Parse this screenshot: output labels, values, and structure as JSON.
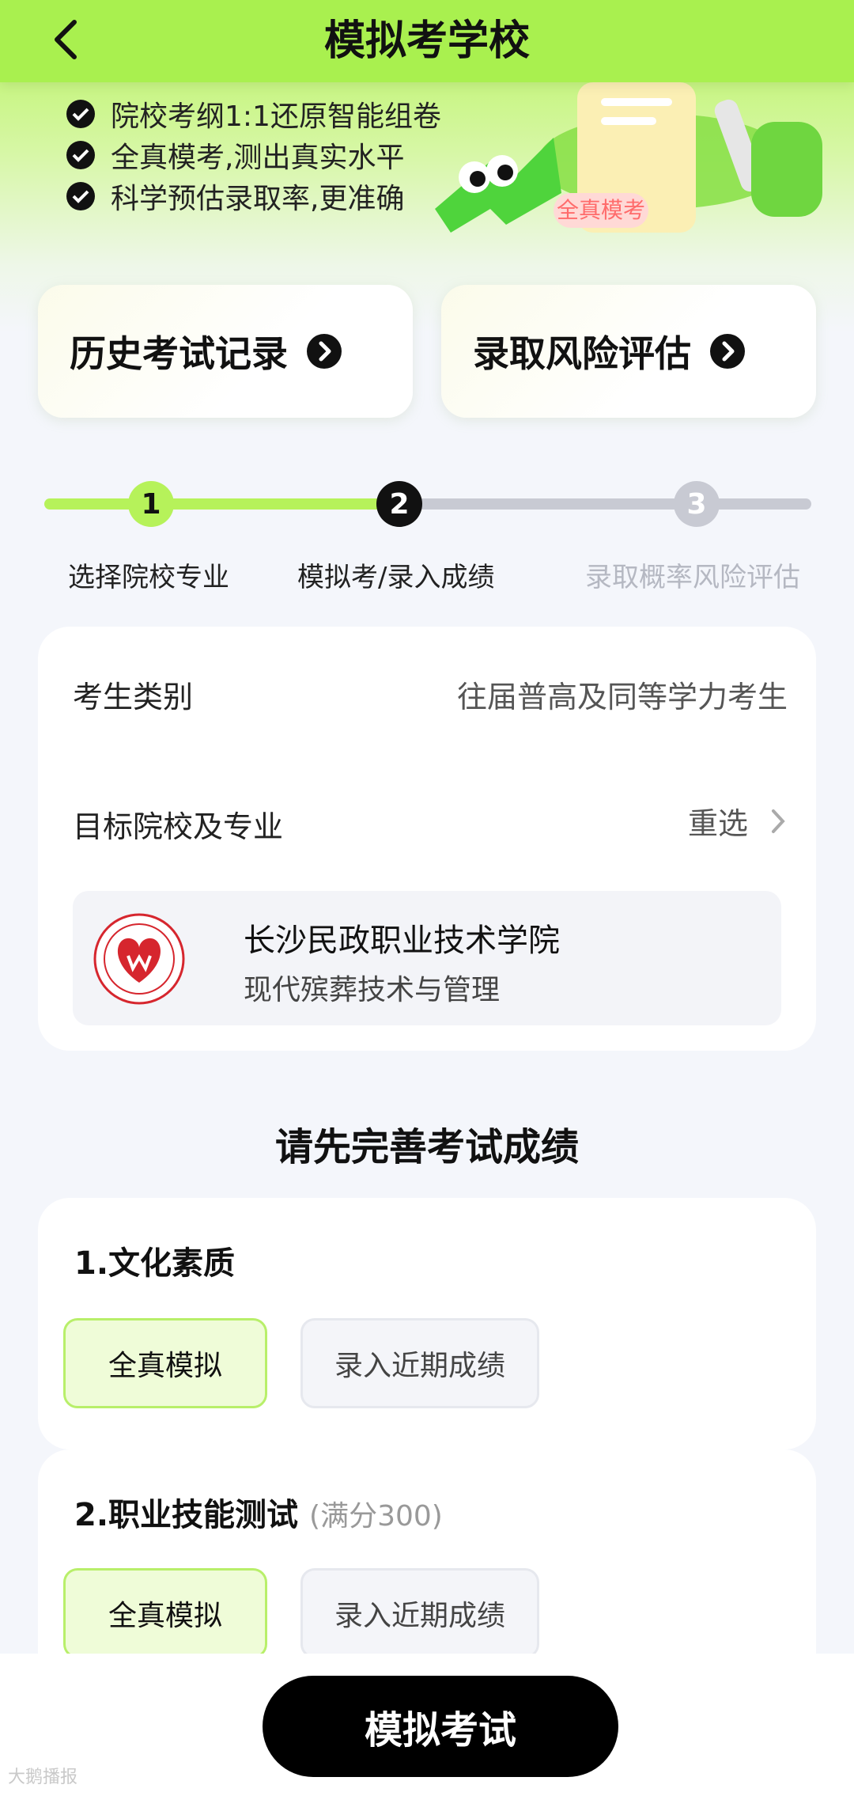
{
  "header": {
    "title": "模拟考学校"
  },
  "features": [
    "院校考纲1:1还原智能组卷",
    "全真模考,测出真实水平",
    "科学预估录取率,更准确"
  ],
  "banner": {
    "tag": "全真模考"
  },
  "quick_actions": [
    {
      "label": "历史考试记录"
    },
    {
      "label": "录取风险评估"
    }
  ],
  "steps": [
    {
      "num": "1",
      "label": "选择院校专业",
      "state": "done"
    },
    {
      "num": "2",
      "label": "模拟考/录入成绩",
      "state": "current"
    },
    {
      "num": "3",
      "label": "录取概率风险评估",
      "state": "pending"
    }
  ],
  "info": {
    "category_label": "考生类别",
    "category_value": "往届普高及同等学力考生",
    "target_label": "目标院校及专业",
    "reselect": "重选",
    "school_name": "长沙民政职业技术学院",
    "school_major": "现代殡葬技术与管理"
  },
  "section_title": "请先完善考试成绩",
  "scores": [
    {
      "title": "1.文化素质",
      "note": "",
      "options": [
        "全真模拟",
        "录入近期成绩"
      ],
      "selected": 0
    },
    {
      "title": "2.职业技能测试",
      "note": "(满分300)",
      "options": [
        "全真模拟",
        "录入近期成绩"
      ],
      "selected": 0
    }
  ],
  "primary_button": "模拟考试",
  "watermark": "大鹅播报",
  "colors": {
    "accent": "#a9f04f",
    "primary": "#000000"
  }
}
